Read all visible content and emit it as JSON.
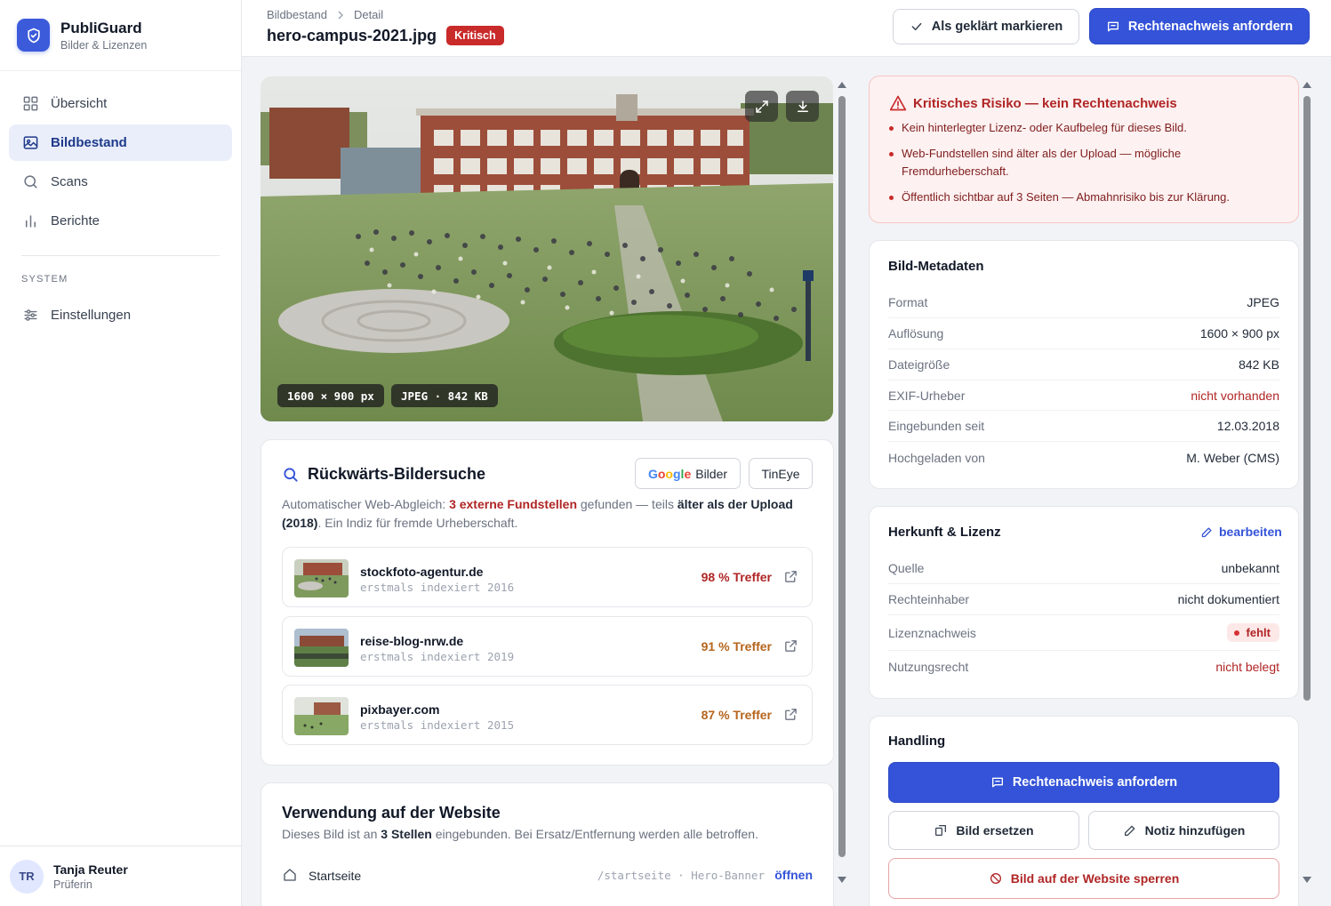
{
  "app": {
    "name": "PubliGuard",
    "subtitle": "Bilder & Lizenzen"
  },
  "sidebar": {
    "items": [
      {
        "label": "Übersicht",
        "icon": "grid-icon"
      },
      {
        "label": "Bildbestand",
        "icon": "image-icon",
        "active": true
      },
      {
        "label": "Scans",
        "icon": "search-icon"
      },
      {
        "label": "Berichte",
        "icon": "bar-chart-icon"
      }
    ],
    "section_label": "SYSTEM",
    "settings_label": "Einstellungen"
  },
  "user": {
    "initials": "TR",
    "name": "Tanja Reuter",
    "role": "Prüferin"
  },
  "header": {
    "breadcrumb": [
      "Bildbestand",
      "Detail"
    ],
    "file_name": "hero-campus-2021.jpg",
    "badge": "Kritisch",
    "mark_resolved": "Als geklärt markieren",
    "request_proof": "Rechtenachweis anfordern"
  },
  "image": {
    "dimensions_tag": "1600 × 900 px",
    "format_tag": "JPEG · 842 KB"
  },
  "reverse_search": {
    "title": "Rückwärts-Bildersuche",
    "google_label": "Google",
    "google_suffix": "Bilder",
    "tineye_label": "TinEye",
    "desc_1": "Automatischer Web-Abgleich: ",
    "desc_found": "3 externe Fundstellen",
    "desc_2": " gefunden — teils ",
    "desc_older": "älter als der Upload (2018)",
    "desc_3": ". Ein Indiz für fremde Urheberschaft.",
    "matches": [
      {
        "domain": "stockfoto-agentur.de",
        "indexed": "erstmals indexiert 2016",
        "score": "98 % Treffer",
        "color": "#b02525"
      },
      {
        "domain": "reise-blog-nrw.de",
        "indexed": "erstmals indexiert 2019",
        "score": "91 % Treffer",
        "color": "#b5651d"
      },
      {
        "domain": "pixbayer.com",
        "indexed": "erstmals indexiert 2015",
        "score": "87 % Treffer",
        "color": "#b5651d"
      }
    ]
  },
  "usage": {
    "title": "Verwendung auf der Website",
    "desc_1": "Dieses Bild ist an ",
    "desc_count": "3 Stellen",
    "desc_2": " eingebunden. Bei Ersatz/Entfernung werden alle betroffen.",
    "rows": [
      {
        "page": "Startseite",
        "path": "/startseite · Hero-Banner",
        "action": "öffnen"
      }
    ]
  },
  "alert": {
    "title": "Kritisches Risiko — kein Rechtenachweis",
    "items": [
      "Kein hinterlegter Lizenz- oder Kaufbeleg für dieses Bild.",
      "Web-Fundstellen sind älter als der Upload — mögliche Fremdurheberschaft.",
      "Öffentlich sichtbar auf 3 Seiten — Abmahnrisiko bis zur Klärung."
    ]
  },
  "metadata": {
    "title": "Bild-Metadaten",
    "rows": [
      {
        "key": "Format",
        "value": "JPEG"
      },
      {
        "key": "Auflösung",
        "value": "1600 × 900 px"
      },
      {
        "key": "Dateigröße",
        "value": "842 KB"
      },
      {
        "key": "EXIF-Urheber",
        "value": "nicht vorhanden",
        "status": "red"
      },
      {
        "key": "Eingebunden seit",
        "value": "12.03.2018"
      },
      {
        "key": "Hochgeladen von",
        "value": "M. Weber (CMS)"
      }
    ]
  },
  "license": {
    "title": "Herkunft & Lizenz",
    "edit_label": "bearbeiten",
    "rows": [
      {
        "key": "Quelle",
        "value": "unbekannt"
      },
      {
        "key": "Rechteinhaber",
        "value": "nicht dokumentiert"
      },
      {
        "key": "Lizenznachweis",
        "value": "fehlt",
        "status": "pill"
      },
      {
        "key": "Nutzungsrecht",
        "value": "nicht belegt",
        "status": "red"
      }
    ]
  },
  "handling": {
    "title": "Handling",
    "request_proof": "Rechtenachweis anfordern",
    "replace": "Bild ersetzen",
    "add_note": "Notiz hinzufügen",
    "block": "Bild auf der Website sperren"
  },
  "colors": {
    "primary": "#3453d8",
    "critical": "#c92a2a",
    "warning": "#b5651d"
  }
}
